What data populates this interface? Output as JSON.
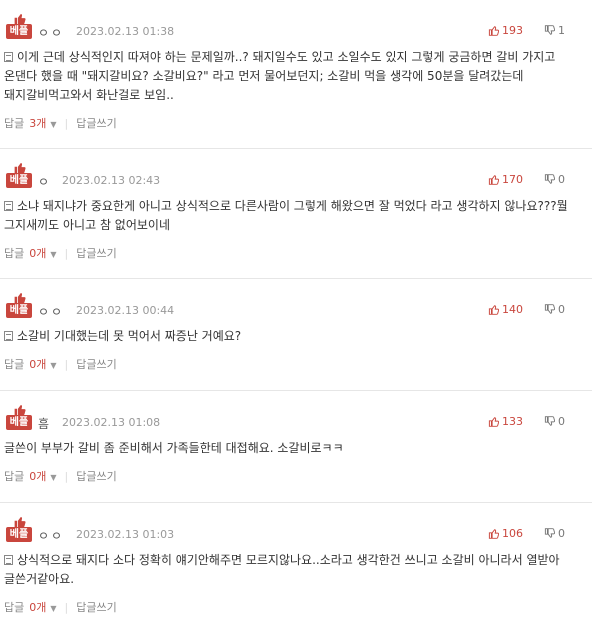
{
  "colors": {
    "accent": "#c9463d",
    "muted": "#999999"
  },
  "labels": {
    "badge": "베플",
    "reply": "답글",
    "write_reply": "답글쓰기"
  },
  "comments": [
    {
      "nickname": "ㅇㅇ",
      "date": "2023.02.13 01:38",
      "likes": "193",
      "dislikes": "1",
      "text": "이게 근데 상식적인지 따져야 하는 문제일까..? 돼지일수도 있고 소일수도 있지 그렇게 궁금하면 갈비 가지고 온댄다 했을 때 \"돼지갈비요? 소갈비요?\" 라고 먼저 물어보던지; 소갈비 먹을 생각에 50분을 달려갔는데 돼지갈비먹고와서 화난걸로 보임..",
      "reply_count": "3개"
    },
    {
      "nickname": "ㅇ",
      "date": "2023.02.13 02:43",
      "likes": "170",
      "dislikes": "0",
      "text": "소냐 돼지냐가 중요한게 아니고 상식적으로 다른사람이 그렇게 해왔으면 잘 먹었다 라고 생각하지 않나요???뭘 그지새끼도 아니고 참 없어보이네",
      "reply_count": "0개"
    },
    {
      "nickname": "ㅇㅇ",
      "date": "2023.02.13 00:44",
      "likes": "140",
      "dislikes": "0",
      "text": "소갈비 기대했는데 못 먹어서 짜증난 거예요?",
      "reply_count": "0개"
    },
    {
      "nickname": "흠",
      "date": "2023.02.13 01:08",
      "likes": "133",
      "dislikes": "0",
      "text": "글쓴이 부부가 갈비 좀 준비해서 가족들한테 대접해요. 소갈비로ㅋㅋ",
      "reply_count": "0개"
    },
    {
      "nickname": "ㅇㅇ",
      "date": "2023.02.13 01:03",
      "likes": "106",
      "dislikes": "0",
      "text": "상식적으로 돼지다 소다 정확히 얘기안해주면 모르지않나요..소라고 생각한건 쓰니고 소갈비 아니라서 열받아 글쓴거같아요.",
      "reply_count": "0개"
    }
  ]
}
